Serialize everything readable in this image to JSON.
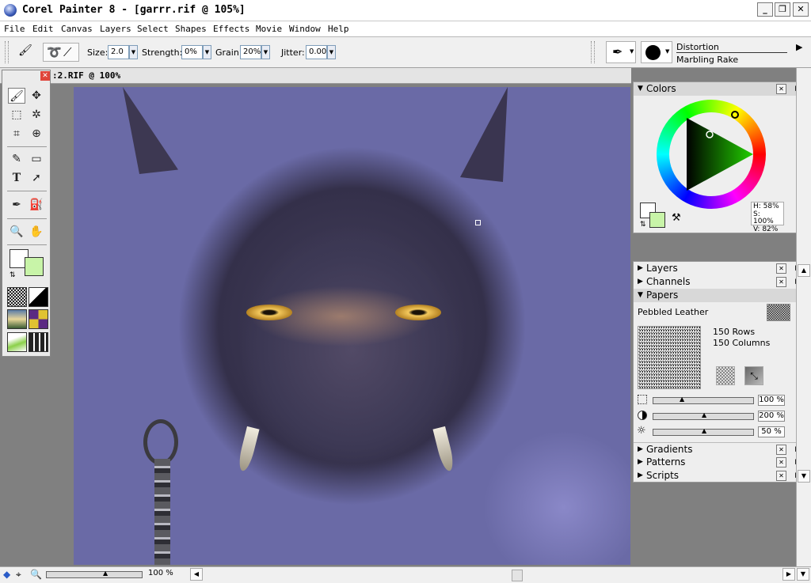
{
  "window": {
    "title": "Corel Painter 8 - [garrr.rif @ 105%]",
    "controls": {
      "minimize": "_",
      "maximize": "❐",
      "close": "✕"
    }
  },
  "menu": [
    "File",
    "Edit",
    "Canvas",
    "Layers",
    "Select",
    "Shapes",
    "Effects",
    "Movie",
    "Window",
    "Help"
  ],
  "property_bar": {
    "size_label": "Size:",
    "size_value": "2.0",
    "strength_label": "Strength:",
    "strength_value": "0%",
    "grain_label": "Grain:",
    "grain_value": "20%",
    "jitter_label": "Jitter:",
    "jitter_value": "0.00",
    "brush_category": "Distortion",
    "brush_variant": "Marbling Rake"
  },
  "document": {
    "title": ":2.RIF @ 100%"
  },
  "colors_panel": {
    "title": "Colors",
    "h": "H: 58%",
    "s": "S: 100%",
    "v": "V: 82%",
    "primary_color": "#ffffff",
    "secondary_color": "#c8f4a8"
  },
  "panels": {
    "layers": "Layers",
    "channels": "Channels",
    "papers": "Papers",
    "gradients": "Gradients",
    "patterns": "Patterns",
    "scripts": "Scripts"
  },
  "papers": {
    "name": "Pebbled Leather",
    "rows": "150 Rows",
    "columns": "150 Columns",
    "scale": "100 %",
    "contrast": "200 %",
    "brightness": "50 %"
  },
  "status": {
    "zoom": "100 %"
  }
}
